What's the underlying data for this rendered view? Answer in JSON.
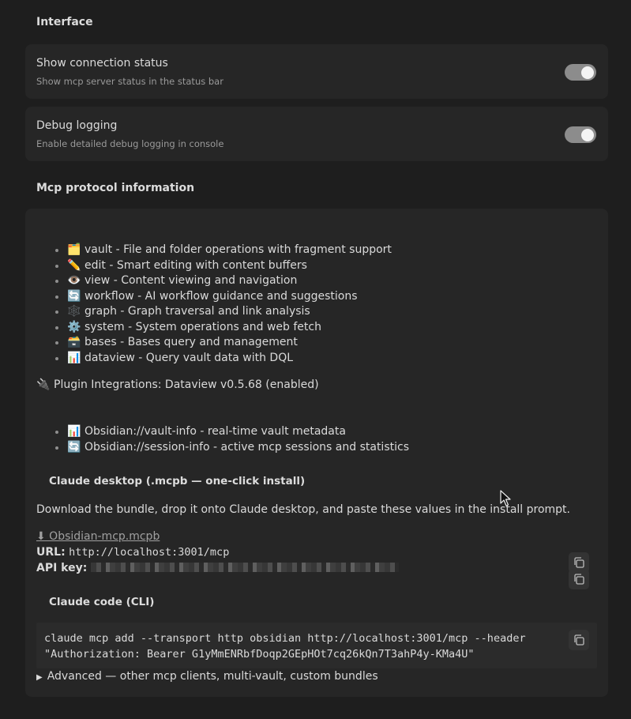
{
  "interface": {
    "heading": "Interface",
    "settings": [
      {
        "name": "Show connection status",
        "desc": "Show mcp server status in the status bar",
        "enabled": true
      },
      {
        "name": "Debug logging",
        "desc": "Enable detailed debug logging in console",
        "enabled": true
      }
    ]
  },
  "protocol": {
    "heading": "Mcp protocol information",
    "tools": [
      {
        "icon": "folder-icon",
        "emoji": "🗂️",
        "text": "vault - File and folder operations with fragment support"
      },
      {
        "icon": "pencil-icon",
        "emoji": "✏️",
        "text": "edit - Smart editing with content buffers"
      },
      {
        "icon": "eye-icon",
        "emoji": "👁️",
        "text": "view - Content viewing and navigation"
      },
      {
        "icon": "cycle-icon",
        "emoji": "🔄",
        "text": "workflow - AI workflow guidance and suggestions"
      },
      {
        "icon": "graph-icon",
        "emoji": "🕸️",
        "text": "graph - Graph traversal and link analysis"
      },
      {
        "icon": "gear-icon",
        "emoji": "⚙️",
        "text": "system - System operations and web fetch"
      },
      {
        "icon": "file-box-icon",
        "emoji": "🗃️",
        "text": "bases - Bases query and management"
      },
      {
        "icon": "bar-chart-icon",
        "emoji": "📊",
        "text": "dataview - Query vault data with DQL"
      }
    ],
    "plugin_icon": "🔌",
    "plugin_integrations": "Plugin Integrations: Dataview v0.5.68 (enabled)",
    "resources": [
      {
        "icon": "bar-chart-icon",
        "emoji": "📊",
        "text": "Obsidian://vault-info - real-time vault metadata"
      },
      {
        "icon": "cycle-icon",
        "emoji": "🔄",
        "text": "Obsidian://session-info - active mcp sessions and statistics"
      }
    ],
    "desktop": {
      "heading": "Claude desktop (.mcpb — one-click install)",
      "description": "Download the bundle, drop it onto Claude desktop, and paste these values in the install prompt.",
      "download_link": "⬇ Obsidian-mcp.mcpb",
      "url_label": "URL:",
      "url_value": "http://localhost:3001/mcp",
      "api_key_label": "API key:"
    },
    "cli": {
      "heading": "Claude code (CLI)",
      "code_line1": "claude mcp add --transport http obsidian http://localhost:3001/mcp --header",
      "code_line2": "\"Authorization: Bearer G1yMmENRbfDoqp2GEpHOt7cq26kQn7T3ahP4y-KMa4U\""
    },
    "advanced": "Advanced — other mcp clients, multi-vault, custom bundles"
  }
}
